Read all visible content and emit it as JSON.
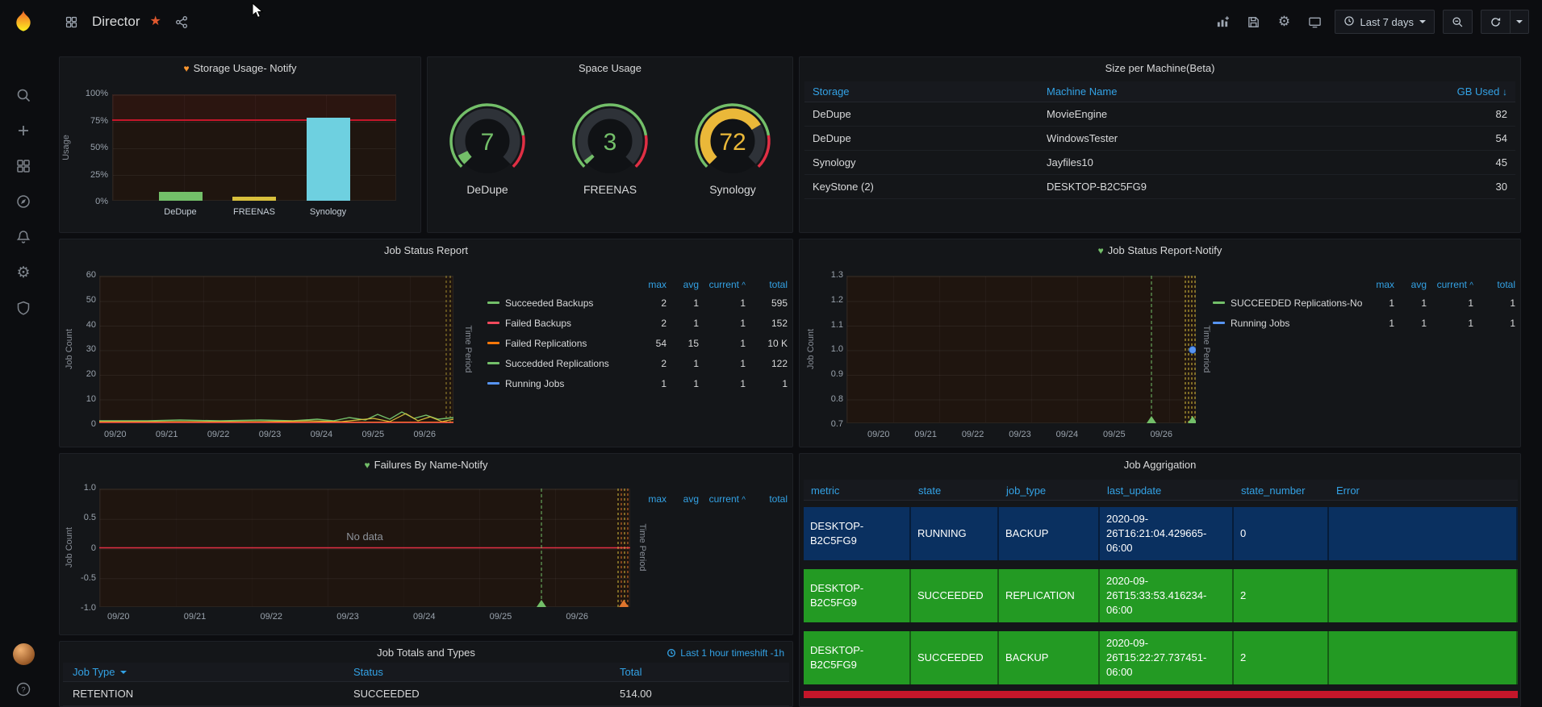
{
  "topbar": {
    "title": "Director",
    "time_range": "Last 7 days"
  },
  "colors": {
    "accent_blue": "#33a2e5",
    "alert_orange": "#ff9830",
    "ok_green": "#73bf69",
    "red": "#c4162a"
  },
  "panels": {
    "storage": {
      "title": "Storage Usage- Notify",
      "alert_color": "#ff9830",
      "ylabel": "Usage",
      "yticks": [
        "100%",
        "75%",
        "50%",
        "25%",
        "0%"
      ],
      "chart_data": {
        "type": "bar",
        "categories": [
          "DeDupe",
          "FREENAS",
          "Synology"
        ],
        "values": [
          8,
          4,
          78
        ],
        "unit": "%",
        "ylim": [
          0,
          100
        ],
        "threshold": 75,
        "colors": [
          "#73bf69",
          "#d8bf3c",
          "#6ed0e0"
        ]
      }
    },
    "space": {
      "title": "Space Usage",
      "gauges": [
        {
          "label": "DeDupe",
          "value": 7,
          "color": "#73bf69"
        },
        {
          "label": "FREENAS",
          "value": 3,
          "color": "#73bf69"
        },
        {
          "label": "Synology",
          "value": 72,
          "color": "#eab839"
        }
      ]
    },
    "size_table": {
      "title": "Size per Machine(Beta)",
      "columns": [
        "Storage",
        "Machine Name",
        "GB Used"
      ],
      "sort_indicator": "↓",
      "rows": [
        [
          "DeDupe",
          "MovieEngine",
          "82"
        ],
        [
          "DeDupe",
          "WindowsTester",
          "54"
        ],
        [
          "Synology",
          "Jayfiles10",
          "45"
        ],
        [
          "KeyStone (2)",
          "DESKTOP-B2C5FG9",
          "30"
        ]
      ]
    },
    "job_status": {
      "title": "Job Status Report",
      "ylabel": "Job Count",
      "right_label": "Time Period",
      "yticks": [
        "60",
        "50",
        "40",
        "30",
        "20",
        "10",
        "0"
      ],
      "xticks": [
        "09/20",
        "09/21",
        "09/22",
        "09/23",
        "09/24",
        "09/25",
        "09/26"
      ],
      "legend_columns": [
        "max",
        "avg",
        "current",
        "total"
      ],
      "sorted_column": "current",
      "series": [
        {
          "name": "Succeeded Backups",
          "color": "#73bf69",
          "max": "2",
          "avg": "1",
          "current": "1",
          "total": "595"
        },
        {
          "name": "Failed Backups",
          "color": "#f2495c",
          "max": "2",
          "avg": "1",
          "current": "1",
          "total": "152"
        },
        {
          "name": "Failed Replications",
          "color": "#ff780a",
          "max": "54",
          "avg": "15",
          "current": "1",
          "total": "10 K"
        },
        {
          "name": "Succedded Replications",
          "color": "#73bf69",
          "max": "2",
          "avg": "1",
          "current": "1",
          "total": "122"
        },
        {
          "name": "Running Jobs",
          "color": "#5794f2",
          "max": "1",
          "avg": "1",
          "current": "1",
          "total": "1"
        }
      ]
    },
    "job_status_notify": {
      "title": "Job Status Report-Notify",
      "alert_color": "#73bf69",
      "ylabel": "Job Count",
      "right_label": "Time Period",
      "yticks": [
        "1.3",
        "1.2",
        "1.1",
        "1.0",
        "0.9",
        "0.8",
        "0.7"
      ],
      "xticks": [
        "09/20",
        "09/21",
        "09/22",
        "09/23",
        "09/24",
        "09/25",
        "09/26"
      ],
      "legend_columns": [
        "max",
        "avg",
        "current",
        "total"
      ],
      "sorted_column": "current",
      "series": [
        {
          "name": "SUCCEEDED Replications-Notify",
          "color": "#73bf69",
          "max": "1",
          "avg": "1",
          "current": "1",
          "total": "1"
        },
        {
          "name": "Running Jobs",
          "color": "#5794f2",
          "max": "1",
          "avg": "1",
          "current": "1",
          "total": "1"
        }
      ]
    },
    "failures": {
      "title": "Failures By Name-Notify",
      "alert_color": "#73bf69",
      "ylabel": "Job Count",
      "right_label": "Time Period",
      "no_data": "No data",
      "yticks": [
        "1.0",
        "0.5",
        "0",
        "-0.5",
        "-1.0"
      ],
      "xticks": [
        "09/20",
        "09/21",
        "09/22",
        "09/23",
        "09/24",
        "09/25",
        "09/26"
      ],
      "legend_columns": [
        "max",
        "avg",
        "current",
        "total"
      ],
      "sorted_column": "current",
      "series": []
    },
    "job_totals": {
      "title": "Job Totals and Types",
      "timeshift": "Last 1 hour timeshift -1h",
      "columns": [
        "Job Type",
        "Status",
        "Total"
      ],
      "rows": [
        [
          "RETENTION",
          "SUCCEEDED",
          "514.00"
        ]
      ]
    },
    "job_agg": {
      "title": "Job Aggrigation",
      "columns": [
        "metric",
        "state",
        "job_type",
        "last_update",
        "state_number",
        "Error"
      ],
      "rows": [
        {
          "metric": "DESKTOP-B2C5FG9",
          "state": "RUNNING",
          "job_type": "BACKUP",
          "last_update": "2020-09-26T16:21:04.429665-06:00",
          "state_number": "0",
          "error": "",
          "color": "#0a3060"
        },
        {
          "metric": "DESKTOP-B2C5FG9",
          "state": "SUCCEEDED",
          "job_type": "REPLICATION",
          "last_update": "2020-09-26T15:33:53.416234-06:00",
          "state_number": "2",
          "error": "",
          "color": "#239a23"
        },
        {
          "metric": "DESKTOP-B2C5FG9",
          "state": "SUCCEEDED",
          "job_type": "BACKUP",
          "last_update": "2020-09-26T15:22:27.737451-06:00",
          "state_number": "2",
          "error": "",
          "color": "#239a23"
        }
      ],
      "overflow_row_color": "#c4162a"
    }
  }
}
